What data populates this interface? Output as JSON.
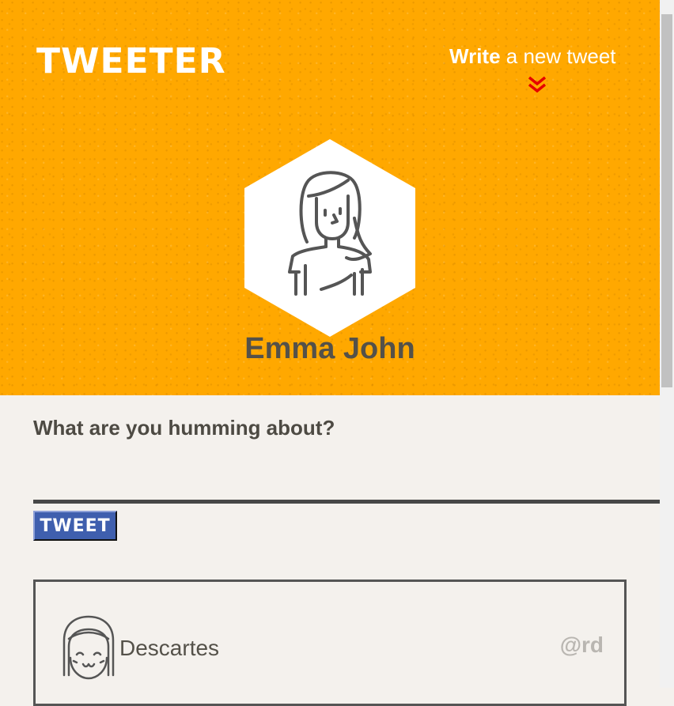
{
  "header": {
    "logo": "TWEETER",
    "write_strong": "Write",
    "write_rest": " a new tweet",
    "chevron_icon": "double-chevron-down-icon",
    "accent_color": "#ffa800",
    "chevron_color": "#e60000"
  },
  "profile": {
    "name": "Emma John",
    "avatar_icon": "woman-avatar-icon"
  },
  "compose": {
    "prompt": "What are you humming about?",
    "input_value": "",
    "submit_label": "TWEET",
    "button_color": "#3f5fae"
  },
  "tweets": [
    {
      "name": "Descartes",
      "handle": "@rd",
      "avatar_icon": "girl-avatar-icon"
    }
  ]
}
